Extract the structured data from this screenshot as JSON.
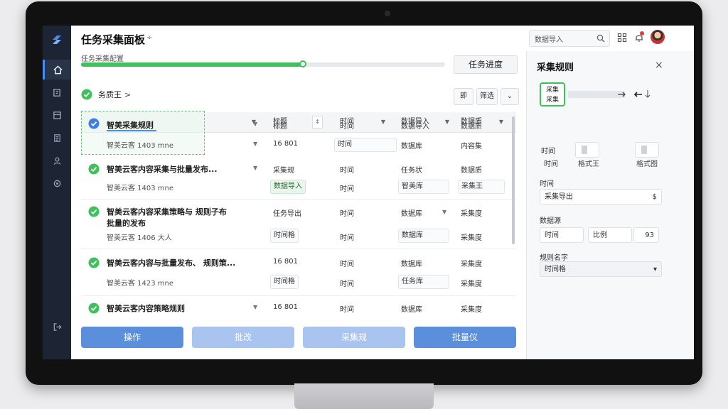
{
  "header": {
    "title": "任务采集面板",
    "title_caret": "÷",
    "search_label": "数据导入"
  },
  "progress": {
    "label": "任务采集配置",
    "percent": 0.61,
    "button_label": "任务进度"
  },
  "crumb": {
    "label": "务质王",
    "arrow": ">"
  },
  "toolbar": {
    "btn1": "即",
    "btn2": "筛选",
    "btn3": "⌄"
  },
  "columns": [
    "",
    "标题",
    "时间",
    "数据导入",
    "数据质"
  ],
  "rows": [
    {
      "title": "智美采集规则",
      "subtitle": "智美云客 1403 mne",
      "c1a": "标题",
      "c1b": "16 801",
      "c2a": "时间",
      "c2b": "时间",
      "c3a": "数据导入",
      "c3b": "数据库",
      "c4a": "数据质",
      "c4b": "内容集"
    },
    {
      "title": "智美云客内容采集与批量发布...",
      "subtitle": "智美云客 1403 mne",
      "c1a": "采集规",
      "c1b": "数据导入",
      "c2a": "时间",
      "c2b": "时间",
      "c3a": "任务状",
      "c3b": "智美库",
      "c4a": "数据质",
      "c4b": "采集王"
    },
    {
      "title": "智美云客内容采集策略与 规则子布",
      "title2": "批量的发布",
      "subtitle": "智美云客 1406 大人",
      "c1a": "任务导出",
      "c1b": "时间格",
      "c2a": "时间",
      "c2b": "时间",
      "c3a": "数据库",
      "c3b": "数据库",
      "c4a": "采集度",
      "c4b": "采集度"
    },
    {
      "title": "智美云客内容与批量发布、 规则策...",
      "subtitle": "智美云客 1423 mne",
      "c1a": "16 801",
      "c1b": "时间格",
      "c2a": "时间",
      "c2b": "时间",
      "c3a": "数据库",
      "c3b": "任务库",
      "c4a": "采集度",
      "c4b": "采集度"
    },
    {
      "title": "智美云客内容策略规则",
      "subtitle": "",
      "c1a": "16 801",
      "c1b": "",
      "c2a": "时间",
      "c2b": "",
      "c3a": "数据库",
      "c3b": "",
      "c4a": "采集度",
      "c4b": ""
    }
  ],
  "actions": [
    {
      "label": "操作",
      "color": "#5b8fdc"
    },
    {
      "label": "批改",
      "color": "#a9c4ee"
    },
    {
      "label": "采集规",
      "color": "#a9c4ee"
    },
    {
      "label": "批量仪",
      "color": "#5b8fdc"
    }
  ],
  "rpanel": {
    "title": "采集规则",
    "close": "×",
    "green_label_1": "采集",
    "green_label_2": "采集",
    "flow_arrows": "→ ← ↓",
    "time_label": "时间",
    "time_label2": "时间",
    "time_val_mid": "格式王",
    "time_val_right": "格式图",
    "section_time": "时间",
    "field1": "采集导出",
    "field1_icon": "$",
    "section_data": "数据源",
    "field2a": "时间",
    "field2b": "比例",
    "field2c": "93",
    "section_rule": "规则名字",
    "field3": "时间格",
    "field3_caret": "▾"
  },
  "colors": {
    "sidebar_bg": "#1d2535",
    "accent_green": "#3ec05b",
    "accent_blue": "#4b8cf2"
  }
}
